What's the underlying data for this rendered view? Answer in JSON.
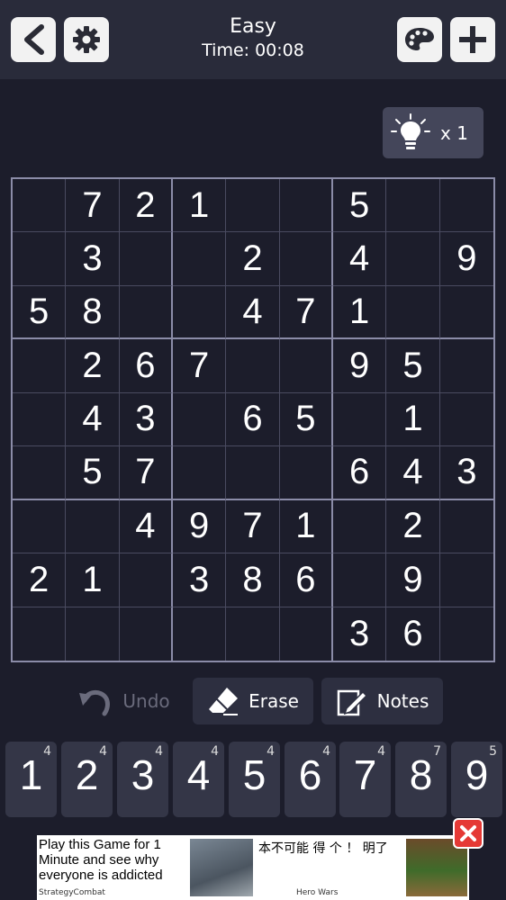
{
  "header": {
    "title": "Easy",
    "timer": "Time: 00:08",
    "icons": [
      "back-arrow-icon",
      "gear-icon",
      "palette-icon",
      "plus-icon"
    ]
  },
  "hint": {
    "icon": "lightbulb-icon",
    "count": "x 1"
  },
  "grid": [
    [
      "",
      "7",
      "2",
      "1",
      "",
      "",
      "5",
      "",
      ""
    ],
    [
      "",
      "3",
      "",
      "",
      "2",
      "",
      "4",
      "",
      "9"
    ],
    [
      "5",
      "8",
      "",
      "",
      "4",
      "7",
      "1",
      "",
      ""
    ],
    [
      "",
      "2",
      "6",
      "7",
      "",
      "",
      "9",
      "5",
      ""
    ],
    [
      "",
      "4",
      "3",
      "",
      "6",
      "5",
      "",
      "1",
      ""
    ],
    [
      "",
      "5",
      "7",
      "",
      "",
      "",
      "6",
      "4",
      "3"
    ],
    [
      "",
      "",
      "4",
      "9",
      "7",
      "1",
      "",
      "2",
      ""
    ],
    [
      "2",
      "1",
      "",
      "3",
      "8",
      "6",
      "",
      "9",
      ""
    ],
    [
      "",
      "",
      "",
      "",
      "",
      "",
      "3",
      "6",
      ""
    ]
  ],
  "actions": {
    "undo_label": "Undo",
    "erase_label": "Erase",
    "notes_label": "Notes"
  },
  "numpad": [
    {
      "digit": "1",
      "remaining": "4"
    },
    {
      "digit": "2",
      "remaining": "4"
    },
    {
      "digit": "3",
      "remaining": "4"
    },
    {
      "digit": "4",
      "remaining": "4"
    },
    {
      "digit": "5",
      "remaining": "4"
    },
    {
      "digit": "6",
      "remaining": "4"
    },
    {
      "digit": "7",
      "remaining": "4"
    },
    {
      "digit": "8",
      "remaining": "7"
    },
    {
      "digit": "9",
      "remaining": "5"
    }
  ],
  "ad": {
    "left_text": "Play this Game for 1 Minute and see why everyone is addicted",
    "left_brand": "StrategyCombat",
    "mid_text": "本不可能 得 个 ！ 明了",
    "mid_brand": "Hero Wars"
  },
  "colors": {
    "background": "#1c1d2b",
    "topbar": "#292b3a",
    "grid_border": "#8b8ca8",
    "key": "#343647",
    "close": "#e53935"
  }
}
